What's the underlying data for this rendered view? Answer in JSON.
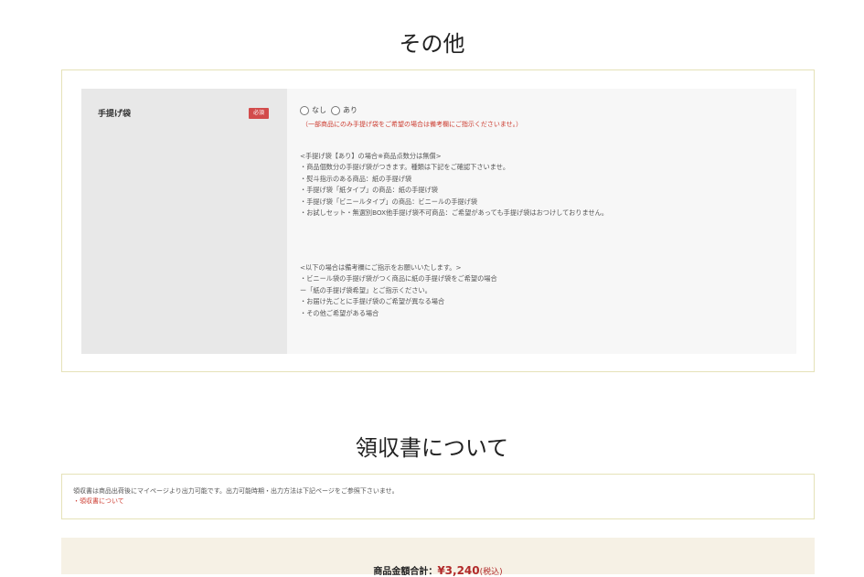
{
  "other": {
    "title": "その他",
    "field_label": "手提げ袋",
    "required_badge": "必須",
    "options": [
      {
        "label": "なし"
      },
      {
        "label": "あり"
      }
    ],
    "note": "（一部商品にのみ手提げ袋をご希望の場合は備考欄にご指示くださいませ。）",
    "info_block_1": [
      "<手提げ袋【あり】の場合※商品点数分は無償>",
      "・商品個数分の手提げ袋がつきます。種類は下記をご確認下さいませ。",
      "・熨斗指示のある商品：紙の手提げ袋",
      "・手提げ袋「紙タイプ」の商品：紙の手提げ袋",
      "・手提げ袋「ビニールタイプ」の商品：ビニールの手提げ袋",
      "・お試しセット・無選別BOX他手提げ袋不可商品：ご希望があっても手提げ袋はおつけしておりません。"
    ],
    "info_block_2": [
      "<以下の場合は備考欄にご指示をお願いいたします。>",
      "・ビニール袋の手提げ袋がつく商品に紙の手提げ袋をご希望の場合",
      "ー「紙の手提げ袋希望」とご指示ください。",
      "・お届け先ごとに手提げ袋のご希望が異なる場合",
      "・その他ご希望がある場合"
    ]
  },
  "receipt": {
    "title": "領収書について",
    "text": "領収書は商品出荷後にマイページより出力可能です。出力可能時期・出力方法は下記ページをご参照下さいませ。",
    "link": "・領収書について"
  },
  "total": {
    "label": "商品金額合計：",
    "price": "¥3,240",
    "tax": "(税込)"
  },
  "colors": {
    "accent_red": "#cc3b2f",
    "badge_red": "#d24b4b",
    "border": "#e5e2b8",
    "total_bg": "#f6f1e5"
  }
}
